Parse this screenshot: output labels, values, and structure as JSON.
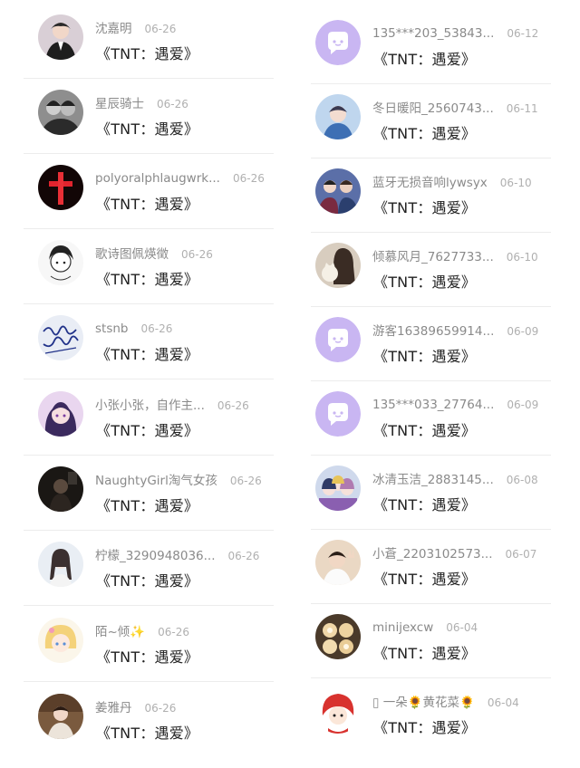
{
  "left": [
    {
      "name": "沈嘉明",
      "date": "06-26",
      "title": "《TNT：遇爱》",
      "avatar": "photo-boy"
    },
    {
      "name": "星辰骑士",
      "date": "06-26",
      "title": "《TNT：遇爱》",
      "avatar": "photo-bw"
    },
    {
      "name": "polyoralphlaugwrk...",
      "date": "06-26",
      "title": "《TNT：遇爱》",
      "avatar": "red-cross"
    },
    {
      "name": "歌诗图佩煐徵",
      "date": "06-26",
      "title": "《TNT：遇爱》",
      "avatar": "sketch-girl"
    },
    {
      "name": "stsnb",
      "date": "06-26",
      "title": "《TNT：遇爱》",
      "avatar": "handwriting"
    },
    {
      "name": "小张小张，自作主...",
      "date": "06-26",
      "title": "《TNT：遇爱》",
      "avatar": "anime-girl"
    },
    {
      "name": "NaughtyGirl淘气女孩",
      "date": "06-26",
      "title": "《TNT：遇爱》",
      "avatar": "dark-photo"
    },
    {
      "name": "柠檬_3290948036...",
      "date": "06-26",
      "title": "《TNT：遇爱》",
      "avatar": "girl-light"
    },
    {
      "name": "陌~倾✨",
      "date": "06-26",
      "title": "《TNT：遇爱》",
      "avatar": "cartoon-blonde"
    },
    {
      "name": "姜雅丹",
      "date": "06-26",
      "title": "《TNT：遇爱》",
      "avatar": "photo-brown"
    }
  ],
  "right": [
    {
      "name": "135***203_53843...",
      "date": "06-12",
      "title": "《TNT：遇爱》",
      "avatar": "default-chat-icon"
    },
    {
      "name": "冬日暖阳_2560743...",
      "date": "06-11",
      "title": "《TNT：遇爱》",
      "avatar": "photo-blue"
    },
    {
      "name": "蓝牙无损音响lywsyx",
      "date": "06-10",
      "title": "《TNT：遇爱》",
      "avatar": "group-photo"
    },
    {
      "name": "倾慕风月_7627733...",
      "date": "06-10",
      "title": "《TNT：遇爱》",
      "avatar": "girl-cat"
    },
    {
      "name": "游客16389659914...",
      "date": "06-09",
      "title": "《TNT：遇爱》",
      "avatar": "default-chat-icon"
    },
    {
      "name": "135***033_27764...",
      "date": "06-09",
      "title": "《TNT：遇爱》",
      "avatar": "default-chat-icon"
    },
    {
      "name": "冰清玉洁_2883145...",
      "date": "06-08",
      "title": "《TNT：遇爱》",
      "avatar": "anime-group"
    },
    {
      "name": "小蒼_2203102573...",
      "date": "06-07",
      "title": "《TNT：遇爱》",
      "avatar": "photo-peace"
    },
    {
      "name": "minijexcw",
      "date": "06-04",
      "title": "《TNT：遇爱》",
      "avatar": "cupcakes"
    },
    {
      "name": "▯ 一朵🌻黄花菜🌻",
      "date": "06-04",
      "title": "《TNT：遇爱》",
      "avatar": "cartoon-red"
    }
  ],
  "colors": {
    "default_avatar_bg": "#c9b6f2",
    "divider": "#ececec",
    "name": "#8a8a8a",
    "title": "#222222"
  }
}
